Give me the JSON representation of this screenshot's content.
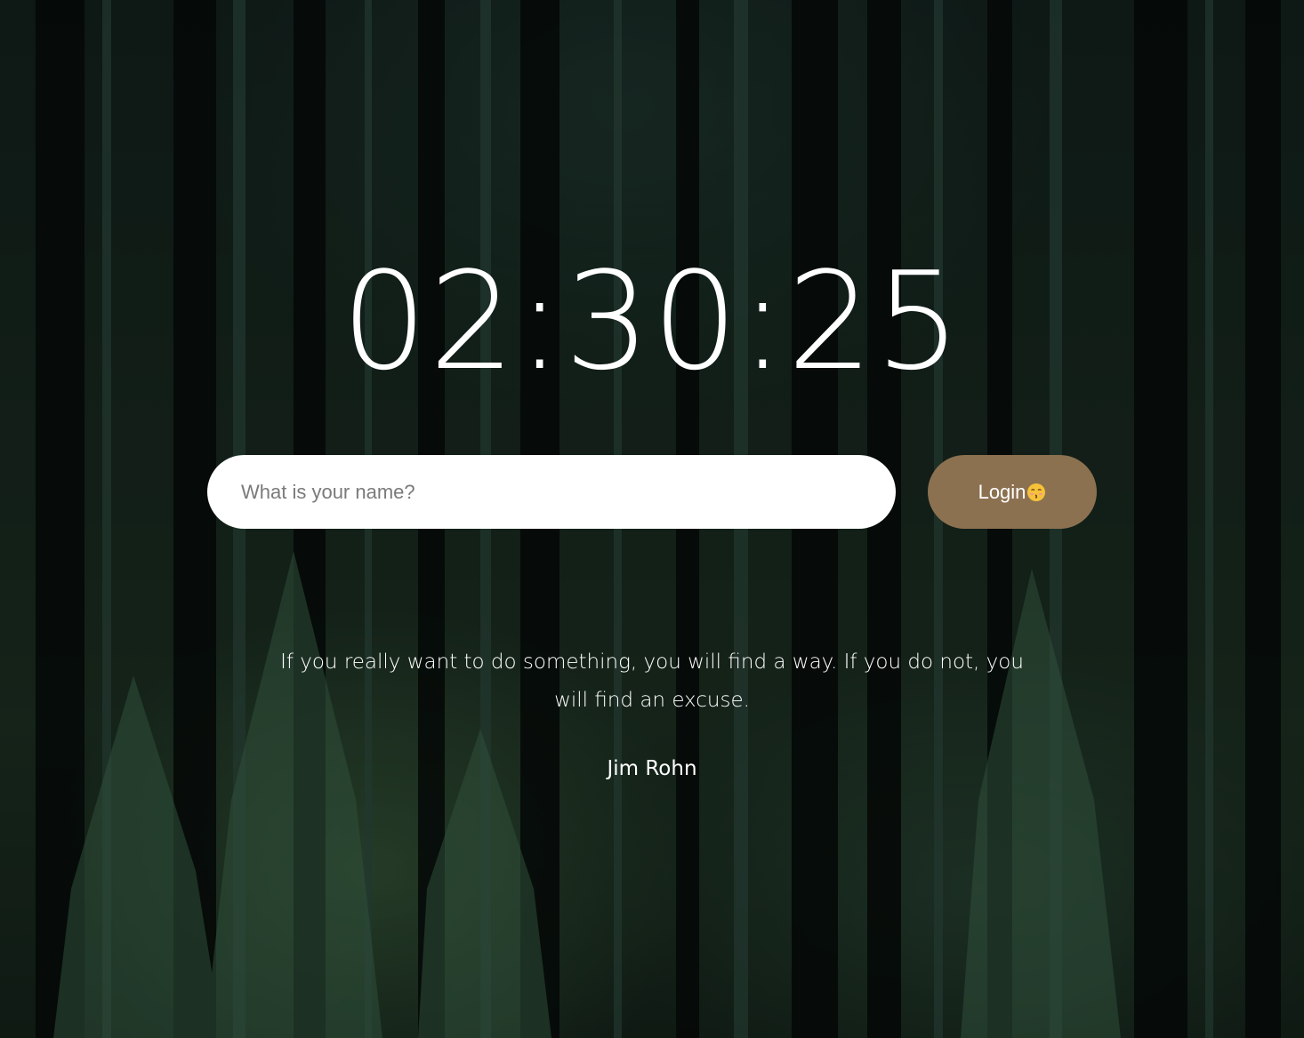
{
  "background": {
    "icon": "forest-background-image"
  },
  "clock": {
    "time": "02:30:25"
  },
  "login": {
    "placeholder": "What is your name?",
    "button_label": "Login",
    "button_icon": "kissing-face-emoji-icon",
    "button_color": "#8c7150"
  },
  "quote": {
    "text": "If you really want to do something, you will find a way. If you do not, you will find an excuse.",
    "author": "Jim Rohn"
  }
}
